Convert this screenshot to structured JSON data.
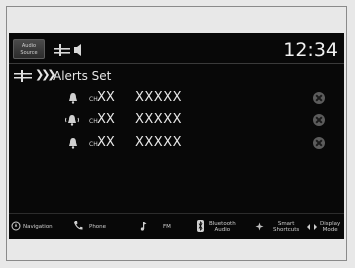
{
  "status_bar": {
    "audio_source_label": [
      "Audio",
      "Source"
    ],
    "clock": "12:34"
  },
  "header": {
    "title": "Alerts Set"
  },
  "alerts": [
    {
      "ch_prefix": "CH",
      "channel": "XX",
      "name": "XXXXX"
    },
    {
      "ch_prefix": "CH",
      "channel": "XX",
      "name": "XXXXX"
    },
    {
      "ch_prefix": "CH",
      "channel": "XX",
      "name": "XXXXX"
    }
  ],
  "nav": {
    "navigation": "Navigation",
    "phone": "Phone",
    "fm": "FM",
    "bluetooth_audio": [
      "Bluetooth",
      "Audio"
    ],
    "smart_shortcuts": [
      "Smart",
      "Shortcuts"
    ],
    "display_mode": [
      "Display",
      "Mode"
    ]
  },
  "colors": {
    "screen_bg": "#080808",
    "text": "#e8e8e8",
    "delete_icon": "#5c5c5c"
  }
}
